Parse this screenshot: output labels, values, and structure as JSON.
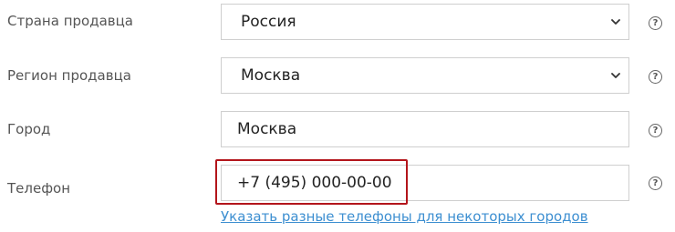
{
  "form": {
    "country": {
      "label": "Страна продавца",
      "value": "Россия",
      "help_icon": "help-circle-icon",
      "dropdown_icon": "chevron-down-icon"
    },
    "region": {
      "label": "Регион продавца",
      "value": "Москва",
      "help_icon": "help-circle-icon",
      "dropdown_icon": "chevron-down-icon"
    },
    "city": {
      "label": "Город",
      "value": "Москва",
      "help_icon": "help-circle-icon"
    },
    "phone": {
      "label": "Телефон",
      "value": "+7 (495) 000-00-00",
      "help_icon": "help-circle-icon",
      "link_text": "Указать разные телефоны для некоторых городов"
    },
    "help_glyph": "?",
    "highlight_color": "#b3151b",
    "link_color": "#3d8fd1"
  }
}
